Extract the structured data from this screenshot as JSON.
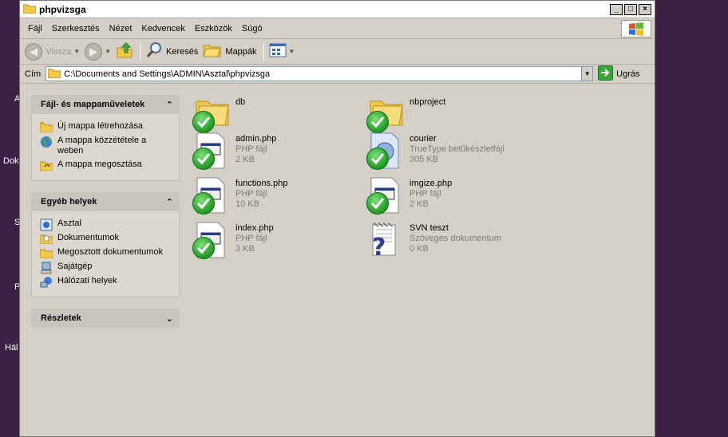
{
  "desktop": {
    "labels": [
      "A",
      "Dok",
      "S",
      "P",
      "Hál"
    ]
  },
  "window": {
    "title": "phpvizsga",
    "controls": {
      "minimize": "_",
      "maximize": "□",
      "close": "×"
    }
  },
  "menu": [
    "Fájl",
    "Szerkesztés",
    "Nézet",
    "Kedvencek",
    "Eszközök",
    "Súgó"
  ],
  "toolbar": {
    "back": "Vissza",
    "search": "Keresés",
    "folders": "Mappák"
  },
  "address": {
    "label": "Cím",
    "path": "C:\\Documents and Settings\\ADMIN\\Asztal\\phpvizsga",
    "go": "Ugrás"
  },
  "panels": {
    "tasks": {
      "title": "Fájl- és mappaműveletek",
      "items": [
        "Új mappa létrehozása",
        "A mappa közzététele a weben",
        "A mappa megosztása"
      ]
    },
    "places": {
      "title": "Egyéb helyek",
      "items": [
        "Asztal",
        "Dokumentumok",
        "Megosztott dokumentumok",
        "Sajátgép",
        "Hálózati helyek"
      ]
    },
    "details": {
      "title": "Részletek"
    }
  },
  "files": [
    {
      "name": "db",
      "type": "",
      "size": "",
      "icon": "folder",
      "checked": true
    },
    {
      "name": "nbproject",
      "type": "",
      "size": "",
      "icon": "folder",
      "checked": true
    },
    {
      "name": "admin.php",
      "type": "PHP fájl",
      "size": "2 KB",
      "icon": "php-file",
      "checked": true
    },
    {
      "name": "courier",
      "type": "TrueType betűkészletfájl",
      "size": "305 KB",
      "icon": "font-file",
      "checked": true
    },
    {
      "name": "functions.php",
      "type": "PHP fájl",
      "size": "10 KB",
      "icon": "php-file",
      "checked": true
    },
    {
      "name": "imgize.php",
      "type": "PHP fájl",
      "size": "2 KB",
      "icon": "php-file",
      "checked": true
    },
    {
      "name": "index.php",
      "type": "PHP fájl",
      "size": "3 KB",
      "icon": "php-file",
      "checked": true
    },
    {
      "name": "SVN teszt",
      "type": "Szöveges dokumentum",
      "size": "0 KB",
      "icon": "unknown-text-file",
      "checked": false
    }
  ]
}
